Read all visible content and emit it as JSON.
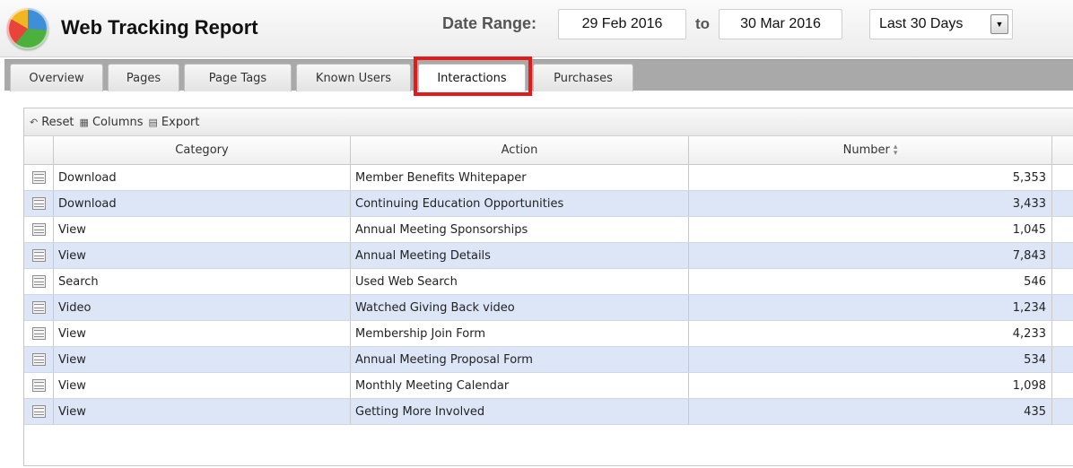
{
  "header": {
    "title": "Web Tracking Report",
    "date_range_label": "Date Range:",
    "date_from": "29 Feb 2016",
    "to_label": "to",
    "date_to": "30 Mar 2016",
    "preset": "Last 30 Days"
  },
  "tabs": [
    {
      "label": "Overview"
    },
    {
      "label": "Pages"
    },
    {
      "label": "Page Tags"
    },
    {
      "label": "Known Users"
    },
    {
      "label": "Interactions",
      "active": true
    },
    {
      "label": "Purchases"
    }
  ],
  "toolbar": {
    "reset": "Reset",
    "columns": "Columns",
    "export": "Export"
  },
  "table": {
    "headers": [
      "Category",
      "Action",
      "Number"
    ],
    "rows": [
      {
        "category": "Download",
        "action": "Member Benefits Whitepaper",
        "number": "5,353"
      },
      {
        "category": "Download",
        "action": "Continuing Education Opportunities",
        "number": "3,433"
      },
      {
        "category": "View",
        "action": "Annual Meeting Sponsorships",
        "number": "1,045"
      },
      {
        "category": "View",
        "action": "Annual Meeting Details",
        "number": "7,843"
      },
      {
        "category": "Search",
        "action": "Used Web Search",
        "number": "546"
      },
      {
        "category": "Video",
        "action": "Watched Giving Back video",
        "number": "1,234"
      },
      {
        "category": "View",
        "action": "Membership Join Form",
        "number": "4,233"
      },
      {
        "category": "View",
        "action": "Annual Meeting Proposal Form",
        "number": "534"
      },
      {
        "category": "View",
        "action": "Monthly Meeting Calendar",
        "number": "1,098"
      },
      {
        "category": "View",
        "action": "Getting More Involved",
        "number": "435"
      }
    ]
  },
  "colors": {
    "highlight": "#e41a1a",
    "alt_row": "#dde6f7",
    "tabbar": "#a9a9a9"
  }
}
